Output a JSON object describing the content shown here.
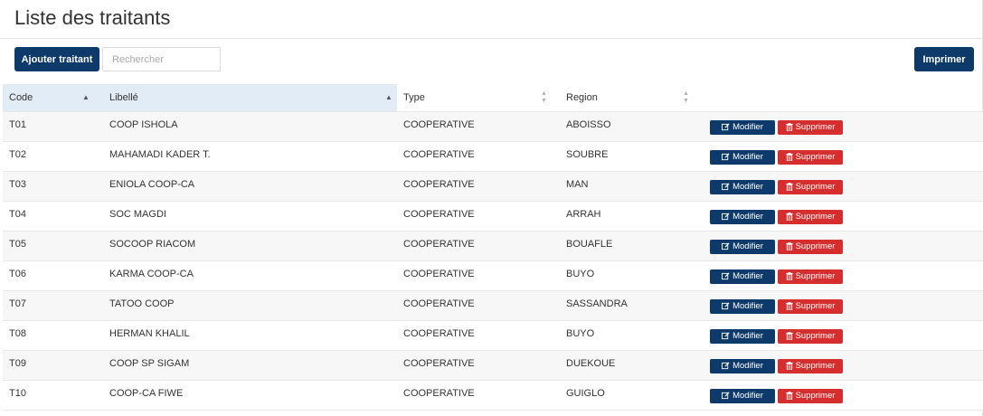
{
  "page": {
    "title": "Liste des traitants"
  },
  "toolbar": {
    "add_label": "Ajouter traitant",
    "search_placeholder": "Rechercher",
    "search_value": "",
    "print_label": "Imprimer"
  },
  "table": {
    "columns": [
      "Code",
      "Libellé",
      "Type",
      "Region"
    ],
    "sort": {
      "column": "Libellé",
      "sorted_columns": [
        "Code",
        "Libellé"
      ],
      "direction": "asc"
    },
    "actions": {
      "edit_label": "Modifier",
      "delete_label": "Supprimer"
    },
    "rows": [
      {
        "code": "T01",
        "libelle": "COOP ISHOLA",
        "type": "COOPERATIVE",
        "region": "ABOISSO"
      },
      {
        "code": "T02",
        "libelle": "MAHAMADI KADER T.",
        "type": "COOPERATIVE",
        "region": "SOUBRE"
      },
      {
        "code": "T03",
        "libelle": "ENIOLA COOP-CA",
        "type": "COOPERATIVE",
        "region": "MAN"
      },
      {
        "code": "T04",
        "libelle": "SOC MAGDI",
        "type": "COOPERATIVE",
        "region": "ARRAH"
      },
      {
        "code": "T05",
        "libelle": "SOCOOP RIACOM",
        "type": "COOPERATIVE",
        "region": "BOUAFLE"
      },
      {
        "code": "T06",
        "libelle": "KARMA COOP-CA",
        "type": "COOPERATIVE",
        "region": "BUYO"
      },
      {
        "code": "T07",
        "libelle": "TATOO COOP",
        "type": "COOPERATIVE",
        "region": "SASSANDRA"
      },
      {
        "code": "T08",
        "libelle": "HERMAN KHALIL",
        "type": "COOPERATIVE",
        "region": "BUYO"
      },
      {
        "code": "T09",
        "libelle": "COOP SP SIGAM",
        "type": "COOPERATIVE",
        "region": "DUEKOUE"
      },
      {
        "code": "T10",
        "libelle": "COOP-CA FIWE",
        "type": "COOPERATIVE",
        "region": "GUIGLO"
      }
    ]
  },
  "colors": {
    "primary": "#0d3a6b",
    "danger": "#d62e2e",
    "sorted_header": "#e1ecf6"
  },
  "icons": {
    "edit": "edit-icon",
    "delete": "trash-icon",
    "sort_asc": "sort-asc-icon",
    "sort_both": "sort-both-icon"
  }
}
